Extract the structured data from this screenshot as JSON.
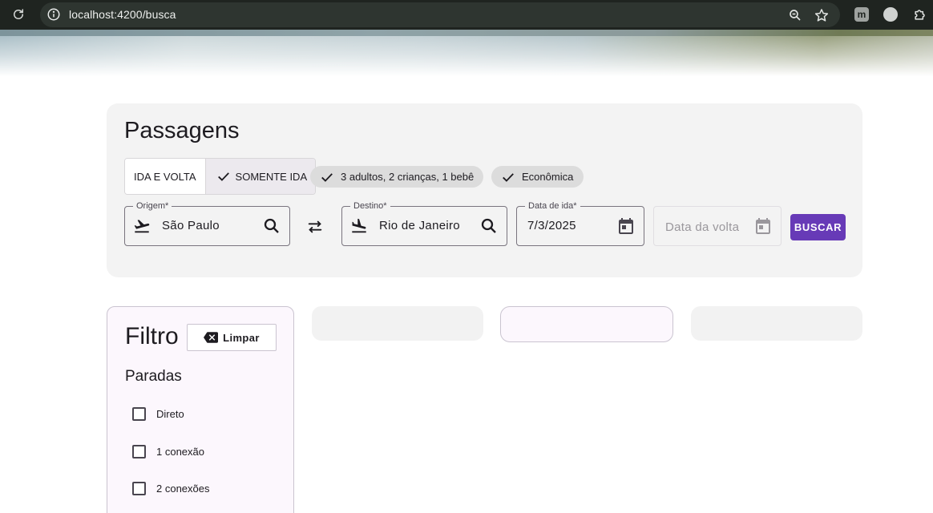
{
  "browser": {
    "url": "localhost:4200/busca",
    "extension_letter": "m"
  },
  "search": {
    "title": "Passagens",
    "trip_type": {
      "options": [
        "IDA E VOLTA",
        "SOMENTE IDA"
      ],
      "selected": "SOMENTE IDA"
    },
    "passengers_chip": "3 adultos, 2 crianças, 1 bebê",
    "class_chip": "Econômica",
    "origin": {
      "label": "Origem*",
      "value": "São Paulo"
    },
    "destination": {
      "label": "Destino*",
      "value": "Rio de Janeiro"
    },
    "departure": {
      "label": "Data de ida*",
      "value": "7/3/2025"
    },
    "return": {
      "placeholder": "Data da volta"
    },
    "search_button": "BUSCAR"
  },
  "filter": {
    "title": "Filtro",
    "clear_button": "Limpar",
    "stops_title": "Paradas",
    "stops": [
      "Direto",
      "1 conexão",
      "2 conexões"
    ]
  },
  "colors": {
    "primary": "#673ab7",
    "card_bg": "#f3f3f3",
    "filter_bg": "#fcf7fd",
    "browser_bar": "#1f2420"
  }
}
